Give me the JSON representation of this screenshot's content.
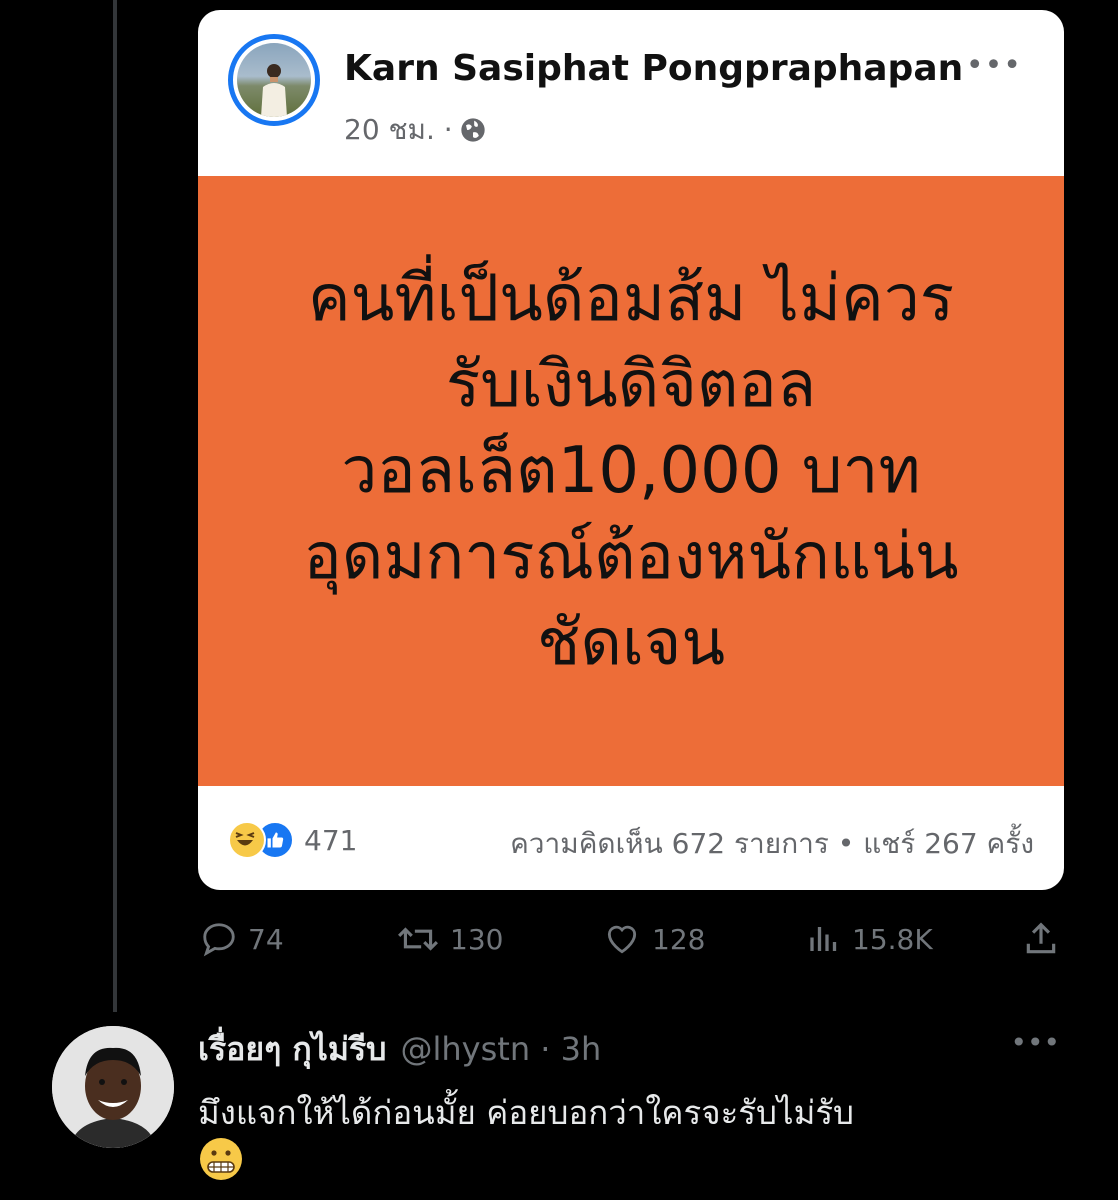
{
  "fb_post": {
    "author": "Karn Sasiphat Pongpraphapan",
    "time": "20 ชม. ·",
    "image_text": [
      "คนที่เป็นด้อมส้ม ไม่ควร",
      "รับเงินดิจิตอล",
      "วอลเล็ต10,000 บาท",
      "อุดมการณ์ต้องหนักแน่น",
      "ชัดเจน"
    ],
    "reaction_count": "471",
    "stats": "ความคิดเห็น 672 รายการ • แชร์ 267 ครั้ง",
    "icons": [
      "globe-icon",
      "more-dots-icon",
      "haha-emoji-icon",
      "like-icon"
    ],
    "colors": {
      "banner": "#ed6d38",
      "accent": "#1877f2"
    }
  },
  "tweet_actions": {
    "replies": "74",
    "retweets": "130",
    "likes": "128",
    "views": "15.8K"
  },
  "reply": {
    "name": "เรื่อยๆ กุไม่รีบ",
    "handle": "@lhystn · 3h",
    "text": "มึงแจกให้ได้ก่อนมั้ย ค่อยบอกว่าใครจะรับไม่รับ",
    "emoji": "grimacing-face-emoji"
  }
}
